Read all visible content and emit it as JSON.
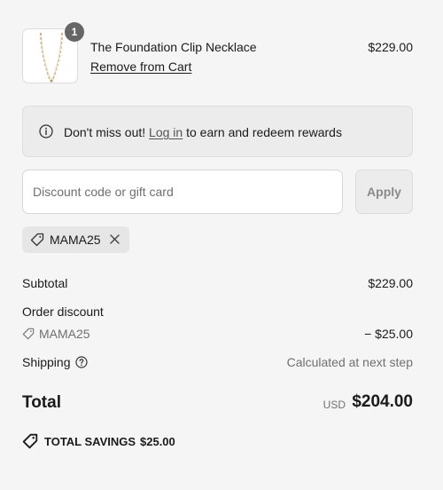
{
  "product": {
    "name": "The Foundation Clip Necklace",
    "remove_label": "Remove from Cart",
    "price": "$229.00",
    "quantity": "1"
  },
  "rewards": {
    "prefix": "Don't miss out! ",
    "login_label": "Log in",
    "suffix": " to earn and redeem rewards",
    "icon": "info-icon"
  },
  "discount": {
    "placeholder": "Discount code or gift card",
    "value": "",
    "apply_label": "Apply",
    "applied_code": "MAMA25"
  },
  "summary": {
    "subtotal_label": "Subtotal",
    "subtotal_value": "$229.00",
    "order_discount_label": "Order discount",
    "discount_code": "MAMA25",
    "discount_value": "− $25.00",
    "shipping_label": "Shipping",
    "shipping_value": "Calculated at next step",
    "total_label": "Total",
    "currency": "USD",
    "total_value": "$204.00",
    "savings_label": "TOTAL SAVINGS",
    "savings_value": "$25.00"
  },
  "colors": {
    "background": "#f5f5f5",
    "badge": "#666666",
    "muted_text": "#707070",
    "chip": "#e6e6e6"
  }
}
